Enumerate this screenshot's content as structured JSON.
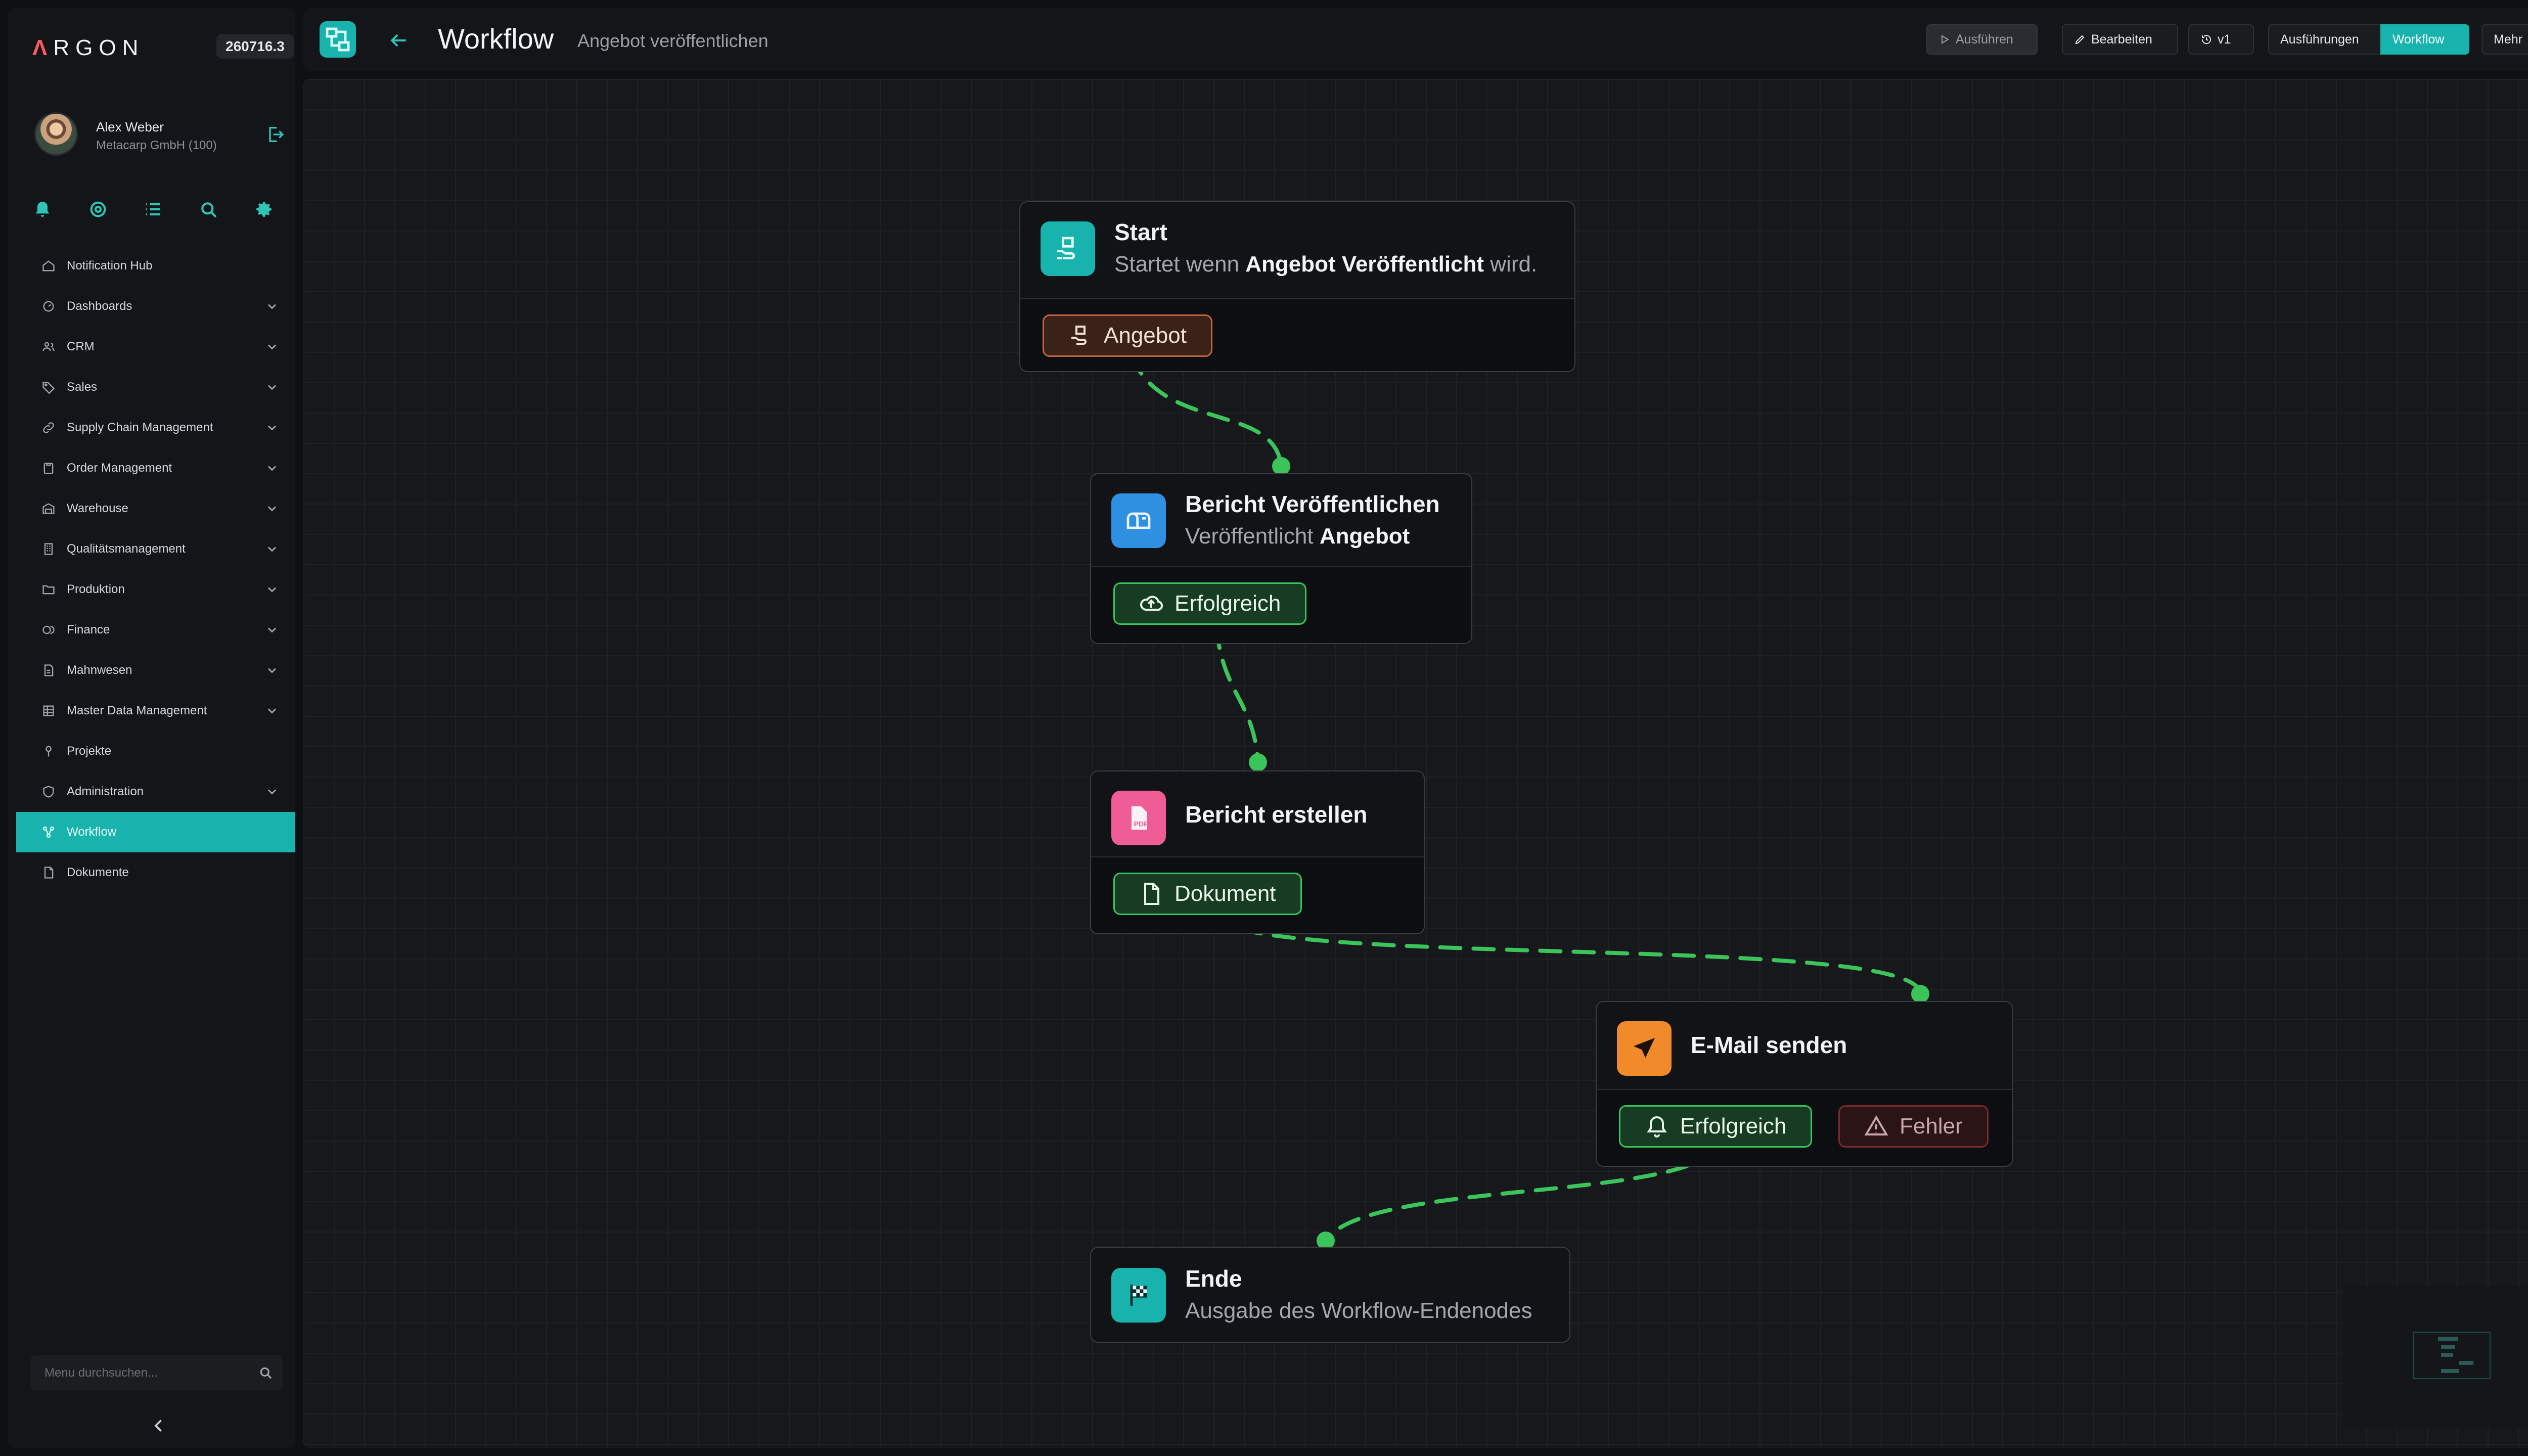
{
  "brand": {
    "name": "RGON",
    "mark": "Λ",
    "version": "260716.3"
  },
  "user": {
    "name": "Alex Weber",
    "org": "Metacarp GmbH (100)"
  },
  "sidebar": {
    "items": [
      {
        "label": "Notification Hub",
        "icon": "home-icon"
      },
      {
        "label": "Dashboards",
        "icon": "dashboard-icon"
      },
      {
        "label": "CRM",
        "icon": "users-icon"
      },
      {
        "label": "Sales",
        "icon": "tag-icon"
      },
      {
        "label": "Supply Chain Management",
        "icon": "link-icon"
      },
      {
        "label": "Order Management",
        "icon": "clipboard-icon"
      },
      {
        "label": "Warehouse",
        "icon": "warehouse-icon"
      },
      {
        "label": "Qualitätsmanagement",
        "icon": "building-icon"
      },
      {
        "label": "Produktion",
        "icon": "folder-icon"
      },
      {
        "label": "Finance",
        "icon": "coins-icon"
      },
      {
        "label": "Mahnwesen",
        "icon": "file-icon"
      },
      {
        "label": "Master Data Management",
        "icon": "grid-icon"
      },
      {
        "label": "Projekte",
        "icon": "pin-icon"
      },
      {
        "label": "Administration",
        "icon": "shield-icon"
      },
      {
        "label": "Workflow",
        "icon": "workflow-icon"
      },
      {
        "label": "Dokumente",
        "icon": "document-icon"
      }
    ],
    "search_placeholder": "Menu durchsuchen..."
  },
  "header": {
    "title": "Workflow",
    "subtitle": "Angebot veröffentlichen",
    "run": "Ausführen",
    "edit": "Bearbeiten",
    "version": "v1",
    "executions": "Ausführungen",
    "workflow": "Workflow",
    "more": "Mehr"
  },
  "nodes": {
    "start": {
      "title": "Start",
      "desc_pre": "Startet wenn ",
      "desc_bold": "Angebot Veröffentlicht",
      "desc_post": " wird.",
      "output": "Angebot"
    },
    "publish": {
      "title": "Bericht Veröffentlichen",
      "desc_pre": "Veröffentlicht ",
      "desc_bold": "Angebot",
      "output": "Erfolgreich"
    },
    "report": {
      "title": "Bericht erstellen",
      "output": "Dokument"
    },
    "email": {
      "title": "E-Mail senden",
      "output_ok": "Erfolgreich",
      "output_err": "Fehler"
    },
    "end": {
      "title": "Ende",
      "desc": "Ausgabe des Workflow-Endenodes"
    }
  },
  "colors": {
    "accent": "#19b3ad",
    "edge": "#3bc45a",
    "start_icon": "#19b3ad",
    "publish_icon": "#2f8fe0",
    "report_icon": "#ef5d97",
    "email_icon": "#f08a2a",
    "end_icon": "#19b3ad"
  }
}
